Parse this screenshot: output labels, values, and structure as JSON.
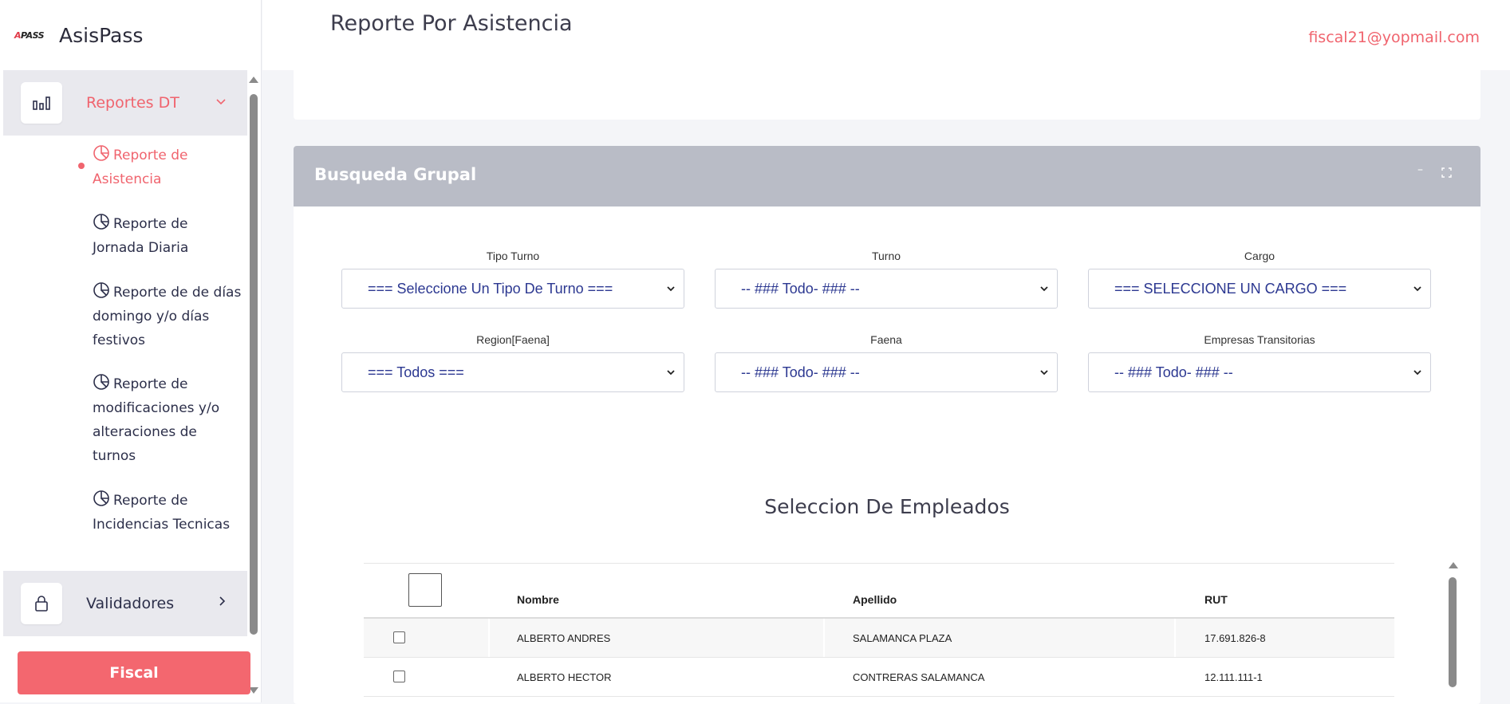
{
  "app": {
    "logo_text": "APASS",
    "name": "AsisPass"
  },
  "header": {
    "title": "Reporte Por Asistencia",
    "user_email": "fiscal21@yopmail.com"
  },
  "sidebar": {
    "reportes": {
      "label": "Reportes DT",
      "icon": "bar-chart-icon",
      "expanded": true,
      "items": [
        {
          "label": "Reporte de Asistencia",
          "icon": "pie-chart-icon",
          "active": true
        },
        {
          "label": "Reporte de Jornada Diaria",
          "icon": "pie-chart-icon"
        },
        {
          "label": "Reporte de de días domingo y/o días festivos",
          "icon": "pie-chart-icon"
        },
        {
          "label": "Reporte de modificaciones y/o alteraciones de turnos",
          "icon": "pie-chart-icon"
        },
        {
          "label": "Reporte de Incidencias Tecnicas",
          "icon": "pie-chart-icon"
        }
      ]
    },
    "validadores": {
      "label": "Validadores",
      "icon": "lock-icon"
    },
    "fiscal_button": "Fiscal"
  },
  "search_card": {
    "title": "Busqueda Grupal",
    "minimize_symbol": "–",
    "filters": {
      "tipo_turno": {
        "label": "Tipo Turno",
        "value": "=== Seleccione Un Tipo De Turno ==="
      },
      "turno": {
        "label": "Turno",
        "value": "-- ### Todo- ### --"
      },
      "cargo": {
        "label": "Cargo",
        "value": "=== SELECCIONE UN CARGO ==="
      },
      "region": {
        "label": "Region[Faena]",
        "value": "=== Todos ==="
      },
      "faena": {
        "label": "Faena",
        "value": "-- ### Todo- ### --"
      },
      "empresas": {
        "label": "Empresas Transitorias",
        "value": "-- ### Todo- ### --"
      }
    },
    "employees_title": "Seleccion De Empleados",
    "table": {
      "columns": [
        "Nombre",
        "Apellido",
        "RUT"
      ],
      "rows": [
        {
          "nombre": "ALBERTO ANDRES",
          "apellido": "SALAMANCA PLAZA",
          "rut": "17.691.826-8"
        },
        {
          "nombre": "ALBERTO HECTOR",
          "apellido": "CONTRERAS SALAMANCA",
          "rut": "12.111.111-1"
        }
      ]
    }
  },
  "colors": {
    "accent": "#f0646e",
    "card_header": "#b9bcc6",
    "select_text": "#2c3891",
    "nav_text": "#2c2f4a"
  }
}
